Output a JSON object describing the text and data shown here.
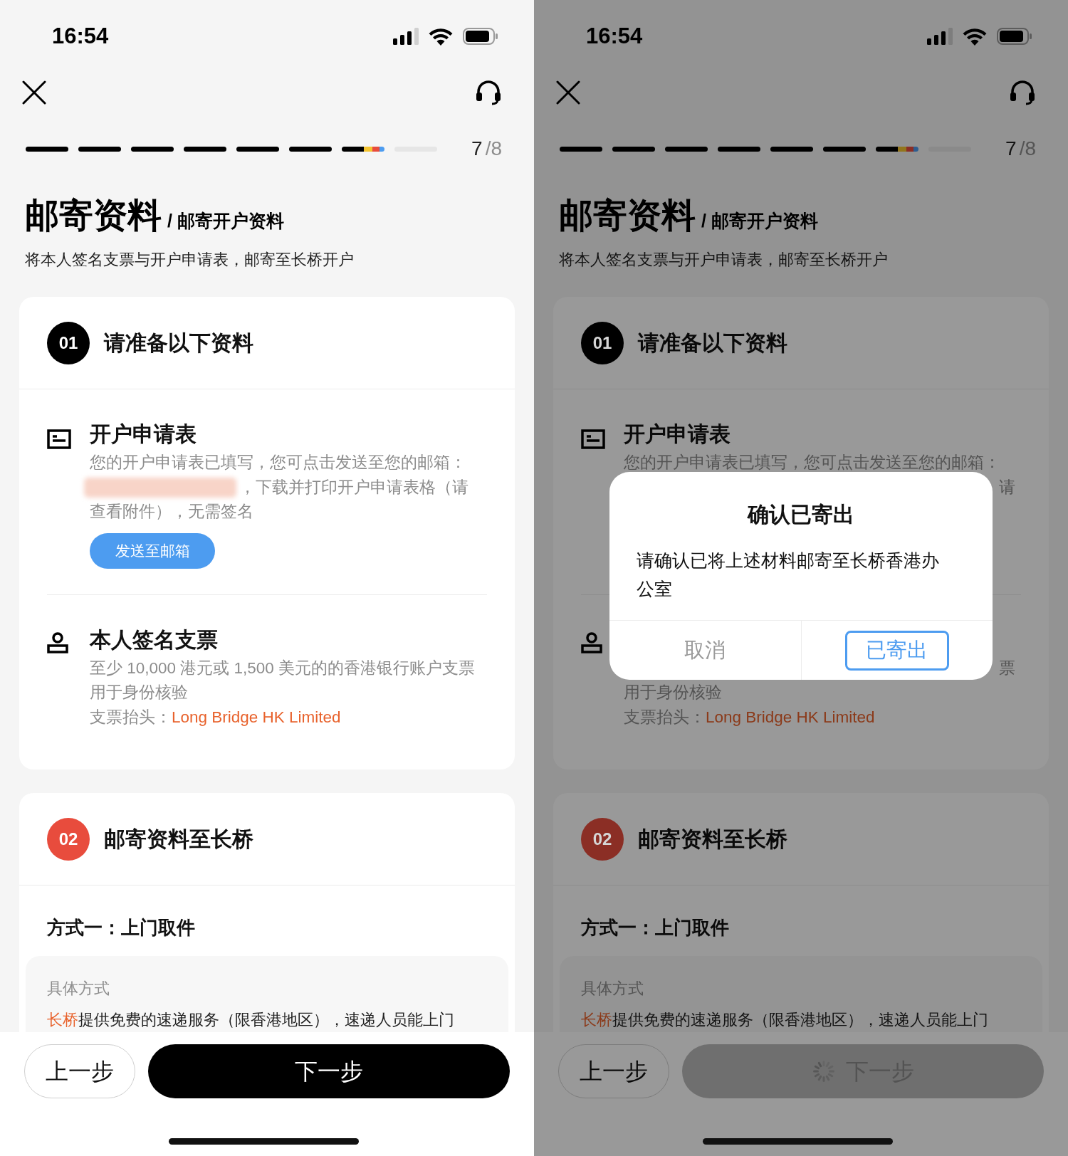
{
  "screens": [
    {
      "status_bar": {
        "time": "16:54"
      },
      "progress": {
        "segments": [
          {
            "kind": "done"
          },
          {
            "kind": "done"
          },
          {
            "kind": "done"
          },
          {
            "kind": "done"
          },
          {
            "kind": "done"
          },
          {
            "kind": "done"
          },
          {
            "kind": "current"
          },
          {
            "kind": "pending"
          }
        ],
        "current": "7",
        "total": "/8"
      },
      "title": "邮寄资料",
      "subtitle": "/ 邮寄开户资料",
      "description": "将本人签名支票与开户申请表，邮寄至长桥开户",
      "prepare_card": {
        "number": "01",
        "color": "#000000",
        "title": "请准备以下资料",
        "items": [
          {
            "title": "开户申请表",
            "lines": [
              {
                "kind": "plain",
                "text": "您的开户申请表已填写，您可点击发送至您的邮箱："
              },
              {
                "kind": "redacted",
                "text": "，下载并打印开户申请表格（请"
              },
              {
                "kind": "plain",
                "text": "查看附件），无需签名"
              }
            ],
            "button": "发送至邮箱"
          },
          {
            "title": "本人签名支票",
            "lines": [
              {
                "kind": "plain",
                "text": "至少 10,000 港元或 1,500 美元的的香港银行账户支票"
              },
              {
                "kind": "plain",
                "text": "用于身份核验"
              },
              {
                "kind": "payee",
                "label": "支票抬头：",
                "value": "Long Bridge HK Limited"
              }
            ]
          }
        ]
      },
      "mail_card": {
        "number": "02",
        "color": "#e84c3d",
        "title": "邮寄资料至长桥",
        "method": "方式一：上门取件",
        "detail_label": "具体方式",
        "detail_highlight": "长桥",
        "detail_text": "提供免费的速递服务（限香港地区），速递人员能上门"
      },
      "nav": {
        "back": "上一步",
        "next": "下一步",
        "next_loading": false
      }
    },
    {
      "status_bar": {
        "time": "16:54"
      },
      "progress": {
        "segments": [
          {
            "kind": "done"
          },
          {
            "kind": "done"
          },
          {
            "kind": "done"
          },
          {
            "kind": "done"
          },
          {
            "kind": "done"
          },
          {
            "kind": "done"
          },
          {
            "kind": "current"
          },
          {
            "kind": "pending"
          }
        ],
        "current": "7",
        "total": "/8"
      },
      "title": "邮寄资料",
      "subtitle": "/ 邮寄开户资料",
      "description": "将本人签名支票与开户申请表，邮寄至长桥开户",
      "prepare_card": {
        "number": "01",
        "color": "#000000",
        "title": "请准备以下资料",
        "items": [
          {
            "title": "开户申请表",
            "lines": [
              {
                "kind": "plain",
                "text": "您的开户申请表已填写，您可点击发送至您的邮箱："
              },
              {
                "kind": "fragment",
                "text": "请"
              },
              {
                "kind": "covered"
              }
            ]
          },
          {
            "lines": [
              {
                "kind": "fragment",
                "text": "票"
              },
              {
                "kind": "plain",
                "text": "用于身份核验"
              },
              {
                "kind": "payee",
                "label": "支票抬头：",
                "value": "Long Bridge HK Limited"
              }
            ]
          }
        ]
      },
      "mail_card": {
        "number": "02",
        "color": "#8b2e25",
        "title": "邮寄资料至长桥",
        "method": "方式一：上门取件",
        "detail_label": "具体方式",
        "detail_highlight": "长桥",
        "detail_text": "提供免费的速递服务（限香港地区），速递人员能上门"
      },
      "nav": {
        "back": "上一步",
        "next": "下一步",
        "next_loading": true
      },
      "dialog": {
        "title": "确认已寄出",
        "message": "请确认已将上述材料邮寄至长桥香港办公室",
        "buttons": [
          {
            "kind": "cancel",
            "label": "取消"
          },
          {
            "kind": "confirm",
            "label": "已寄出"
          }
        ]
      }
    }
  ]
}
